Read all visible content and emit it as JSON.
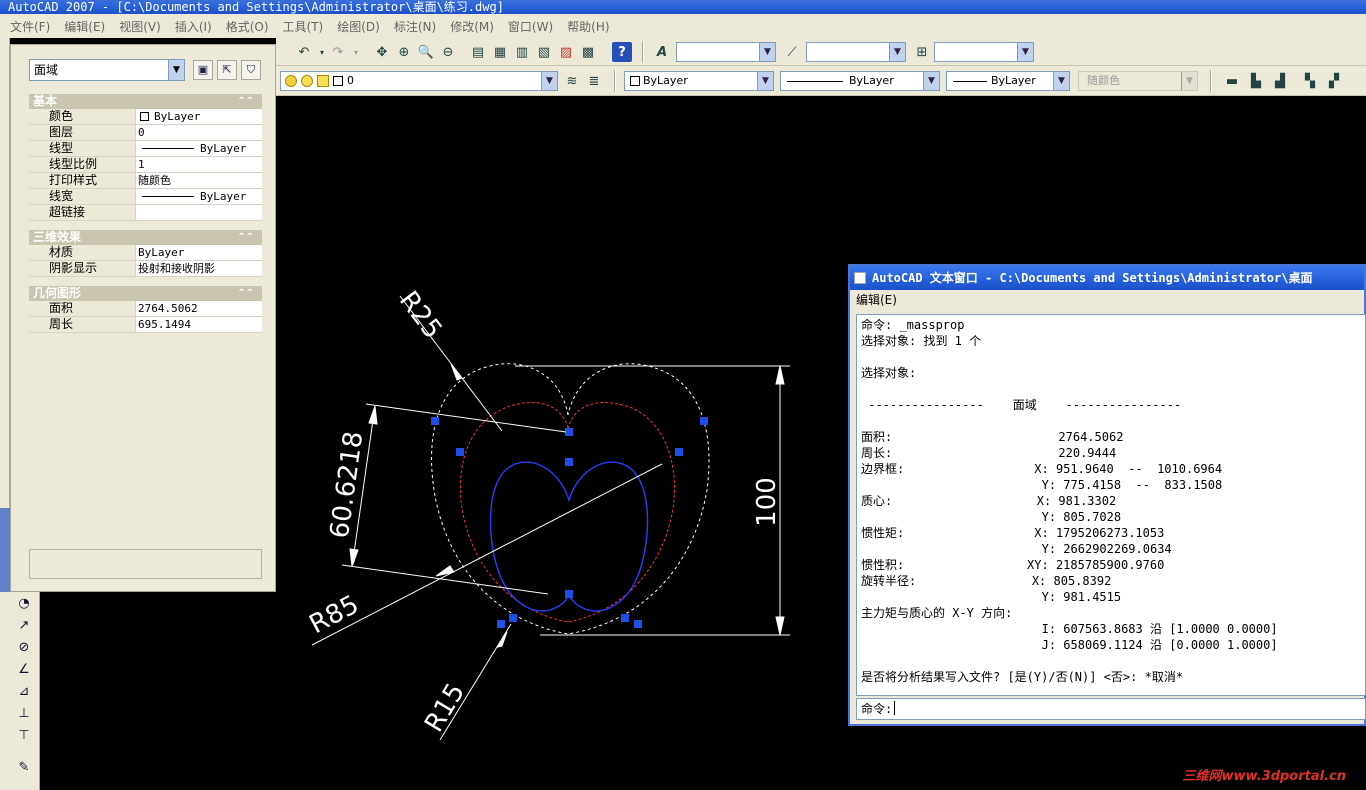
{
  "app": {
    "title": "AutoCAD 2007 - [C:\\Documents and Settings\\Administrator\\桌面\\练习.dwg]"
  },
  "menubar": {
    "items": [
      "文件(F)",
      "编辑(E)",
      "视图(V)",
      "插入(I)",
      "格式(O)",
      "工具(T)",
      "绘图(D)",
      "标注(N)",
      "修改(M)",
      "窗口(W)",
      "帮助(H)"
    ]
  },
  "toolbar": {
    "layer_value": "0",
    "color_value": "ByLayer",
    "linetype_value": "ByLayer",
    "lineweight_value": "ByLayer",
    "plotstyle_value": "随颜色",
    "text_style_value": "",
    "dim_style_value": "",
    "table_style_value": ""
  },
  "properties": {
    "selection": "面域",
    "sections": [
      {
        "title": "基本",
        "rows": [
          {
            "key": "颜色",
            "value": "ByLayer",
            "swatch": true
          },
          {
            "key": "图层",
            "value": "0"
          },
          {
            "key": "线型",
            "value": "ByLayer",
            "line": true
          },
          {
            "key": "线型比例",
            "value": "1"
          },
          {
            "key": "打印样式",
            "value": "随颜色"
          },
          {
            "key": "线宽",
            "value": "ByLayer",
            "line": true
          },
          {
            "key": "超链接",
            "value": ""
          }
        ]
      },
      {
        "title": "三维效果",
        "rows": [
          {
            "key": "材质",
            "value": "ByLayer"
          },
          {
            "key": "阴影显示",
            "value": "投射和接收阴影"
          }
        ]
      },
      {
        "title": "几何图形",
        "rows": [
          {
            "key": "面积",
            "value": "2764.5062"
          },
          {
            "key": "周长",
            "value": "695.1494"
          }
        ]
      }
    ]
  },
  "drawing": {
    "dim_labels": {
      "r25": "R25",
      "r85": "R85",
      "r15": "R15",
      "aligned": "60.6218",
      "height": "100"
    }
  },
  "text_window": {
    "title": "AutoCAD 文本窗口 - C:\\Documents and Settings\\Administrator\\桌面",
    "menu": "编辑(E)",
    "lines": [
      "命令: _massprop",
      "选择对象: 找到 1 个",
      "",
      "选择对象:",
      "",
      " ----------------    面域    ----------------",
      "",
      "面积:                       2764.5062",
      "周长:                       220.9444",
      "边界框:                  X: 951.9640  --  1010.6964",
      "                         Y: 775.4158  --  833.1508",
      "质心:                    X: 981.3302",
      "                         Y: 805.7028",
      "惯性矩:                  X: 1795206273.1053",
      "                         Y: 2662902269.0634",
      "惯性积:                 XY: 2185785900.9760",
      "旋转半径:                X: 805.8392",
      "                         Y: 981.4515",
      "主力矩与质心的 X-Y 方向:",
      "                         I: 607563.8683 沿 [1.0000 0.0000]",
      "                         J: 658069.1124 沿 [0.0000 1.0000]",
      "",
      "是否将分析结果写入文件? [是(Y)/否(N)] <否>: *取消*"
    ],
    "command_prompt": "命令:"
  },
  "watermark": "三维网www.3dportal.cn"
}
